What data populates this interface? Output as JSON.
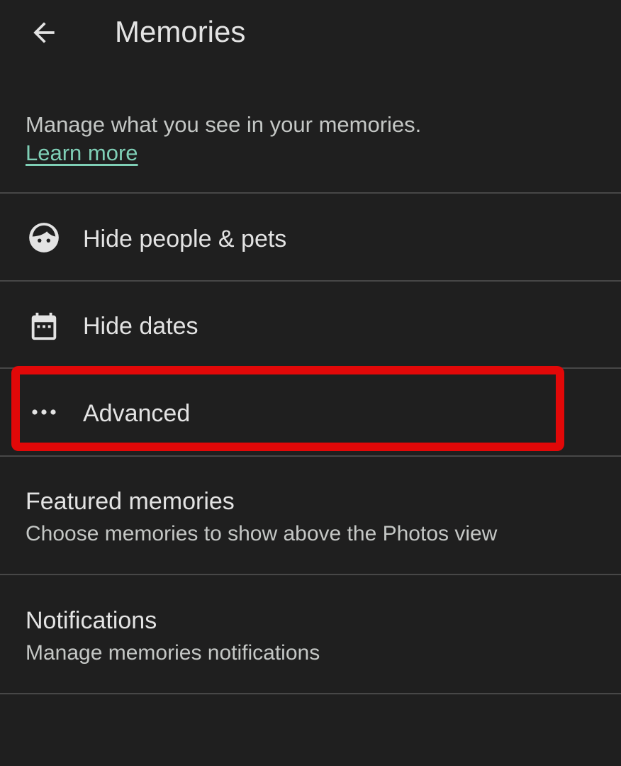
{
  "header": {
    "title": "Memories",
    "back_icon": "arrow-back-icon"
  },
  "intro": {
    "text": "Manage what you see in your memories.",
    "learn_more": "Learn more"
  },
  "menu": [
    {
      "label": "Hide people & pets",
      "icon": "face-icon"
    },
    {
      "label": "Hide dates",
      "icon": "calendar-icon"
    },
    {
      "label": "Advanced",
      "icon": "more-horiz-icon"
    }
  ],
  "featured": {
    "title": "Featured memories",
    "subtitle": "Choose memories to show above the Photos view"
  },
  "notifications": {
    "title": "Notifications",
    "subtitle": "Manage memories notifications"
  },
  "colors": {
    "background": "#1f1f1f",
    "text": "#e3e3e3",
    "secondary_text": "#c4c7c5",
    "link": "#7fcfb6",
    "divider": "#474747",
    "highlight": "#e10808"
  }
}
